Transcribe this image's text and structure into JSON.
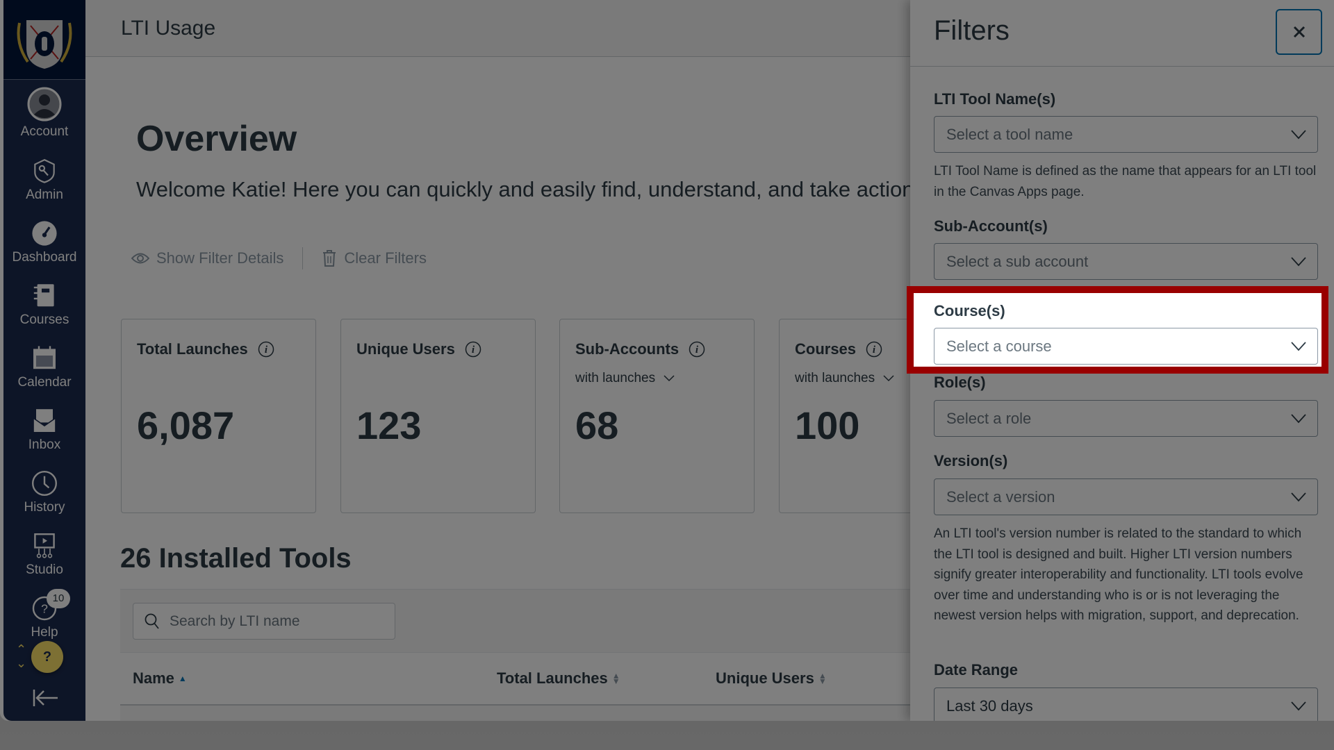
{
  "sidebar": {
    "items": [
      {
        "label": "Account",
        "icon": "user-avatar-icon"
      },
      {
        "label": "Admin",
        "icon": "shield-key-icon"
      },
      {
        "label": "Dashboard",
        "icon": "speedometer-icon"
      },
      {
        "label": "Courses",
        "icon": "notebook-icon"
      },
      {
        "label": "Calendar",
        "icon": "calendar-icon"
      },
      {
        "label": "Inbox",
        "icon": "envelope-icon"
      },
      {
        "label": "History",
        "icon": "clock-icon"
      },
      {
        "label": "Studio",
        "icon": "studio-screen-icon"
      },
      {
        "label": "Help",
        "icon": "question-circle-icon"
      }
    ],
    "help_badge": "10",
    "fab_label": "?"
  },
  "header": {
    "title": "LTI Usage"
  },
  "overview": {
    "title": "Overview",
    "welcome": "Welcome Katie! Here you can quickly and easily find, understand, and take action on",
    "show_filter_details": "Show Filter Details",
    "clear_filters": "Clear Filters"
  },
  "stats": [
    {
      "title": "Total Launches",
      "value": "6,087"
    },
    {
      "title": "Unique Users",
      "value": "123"
    },
    {
      "title": "Sub-Accounts",
      "sub": "with launches",
      "value": "68"
    },
    {
      "title": "Courses",
      "sub": "with launches",
      "value": "100"
    }
  ],
  "tools": {
    "title": "26 Installed Tools",
    "search_placeholder": "Search by LTI name",
    "columns": [
      "Name",
      "Total Launches",
      "Unique Users"
    ]
  },
  "filters": {
    "title": "Filters",
    "close_label": "Close",
    "fields": [
      {
        "label": "LTI Tool Name(s)",
        "placeholder": "Select a tool name",
        "help": "LTI Tool Name is defined as the name that appears for an LTI tool in the Canvas Apps page."
      },
      {
        "label": "Sub-Account(s)",
        "placeholder": "Select a sub account"
      },
      {
        "label": "Course(s)",
        "placeholder": "Select a course"
      },
      {
        "label": "Role(s)",
        "placeholder": "Select a role"
      },
      {
        "label": "Version(s)",
        "placeholder": "Select a version",
        "help": "An LTI tool's version number is related to the standard to which the LTI tool is designed and built. Higher LTI version numbers signify greater interoperability and functionality. LTI tools evolve over time and understanding who is or is not leveraging the newest version helps with migration, support, and deprecation."
      },
      {
        "label": "Date Range",
        "value": "Last 30 days"
      }
    ]
  },
  "highlight": {
    "color": "#990000",
    "target": "Course(s)"
  }
}
